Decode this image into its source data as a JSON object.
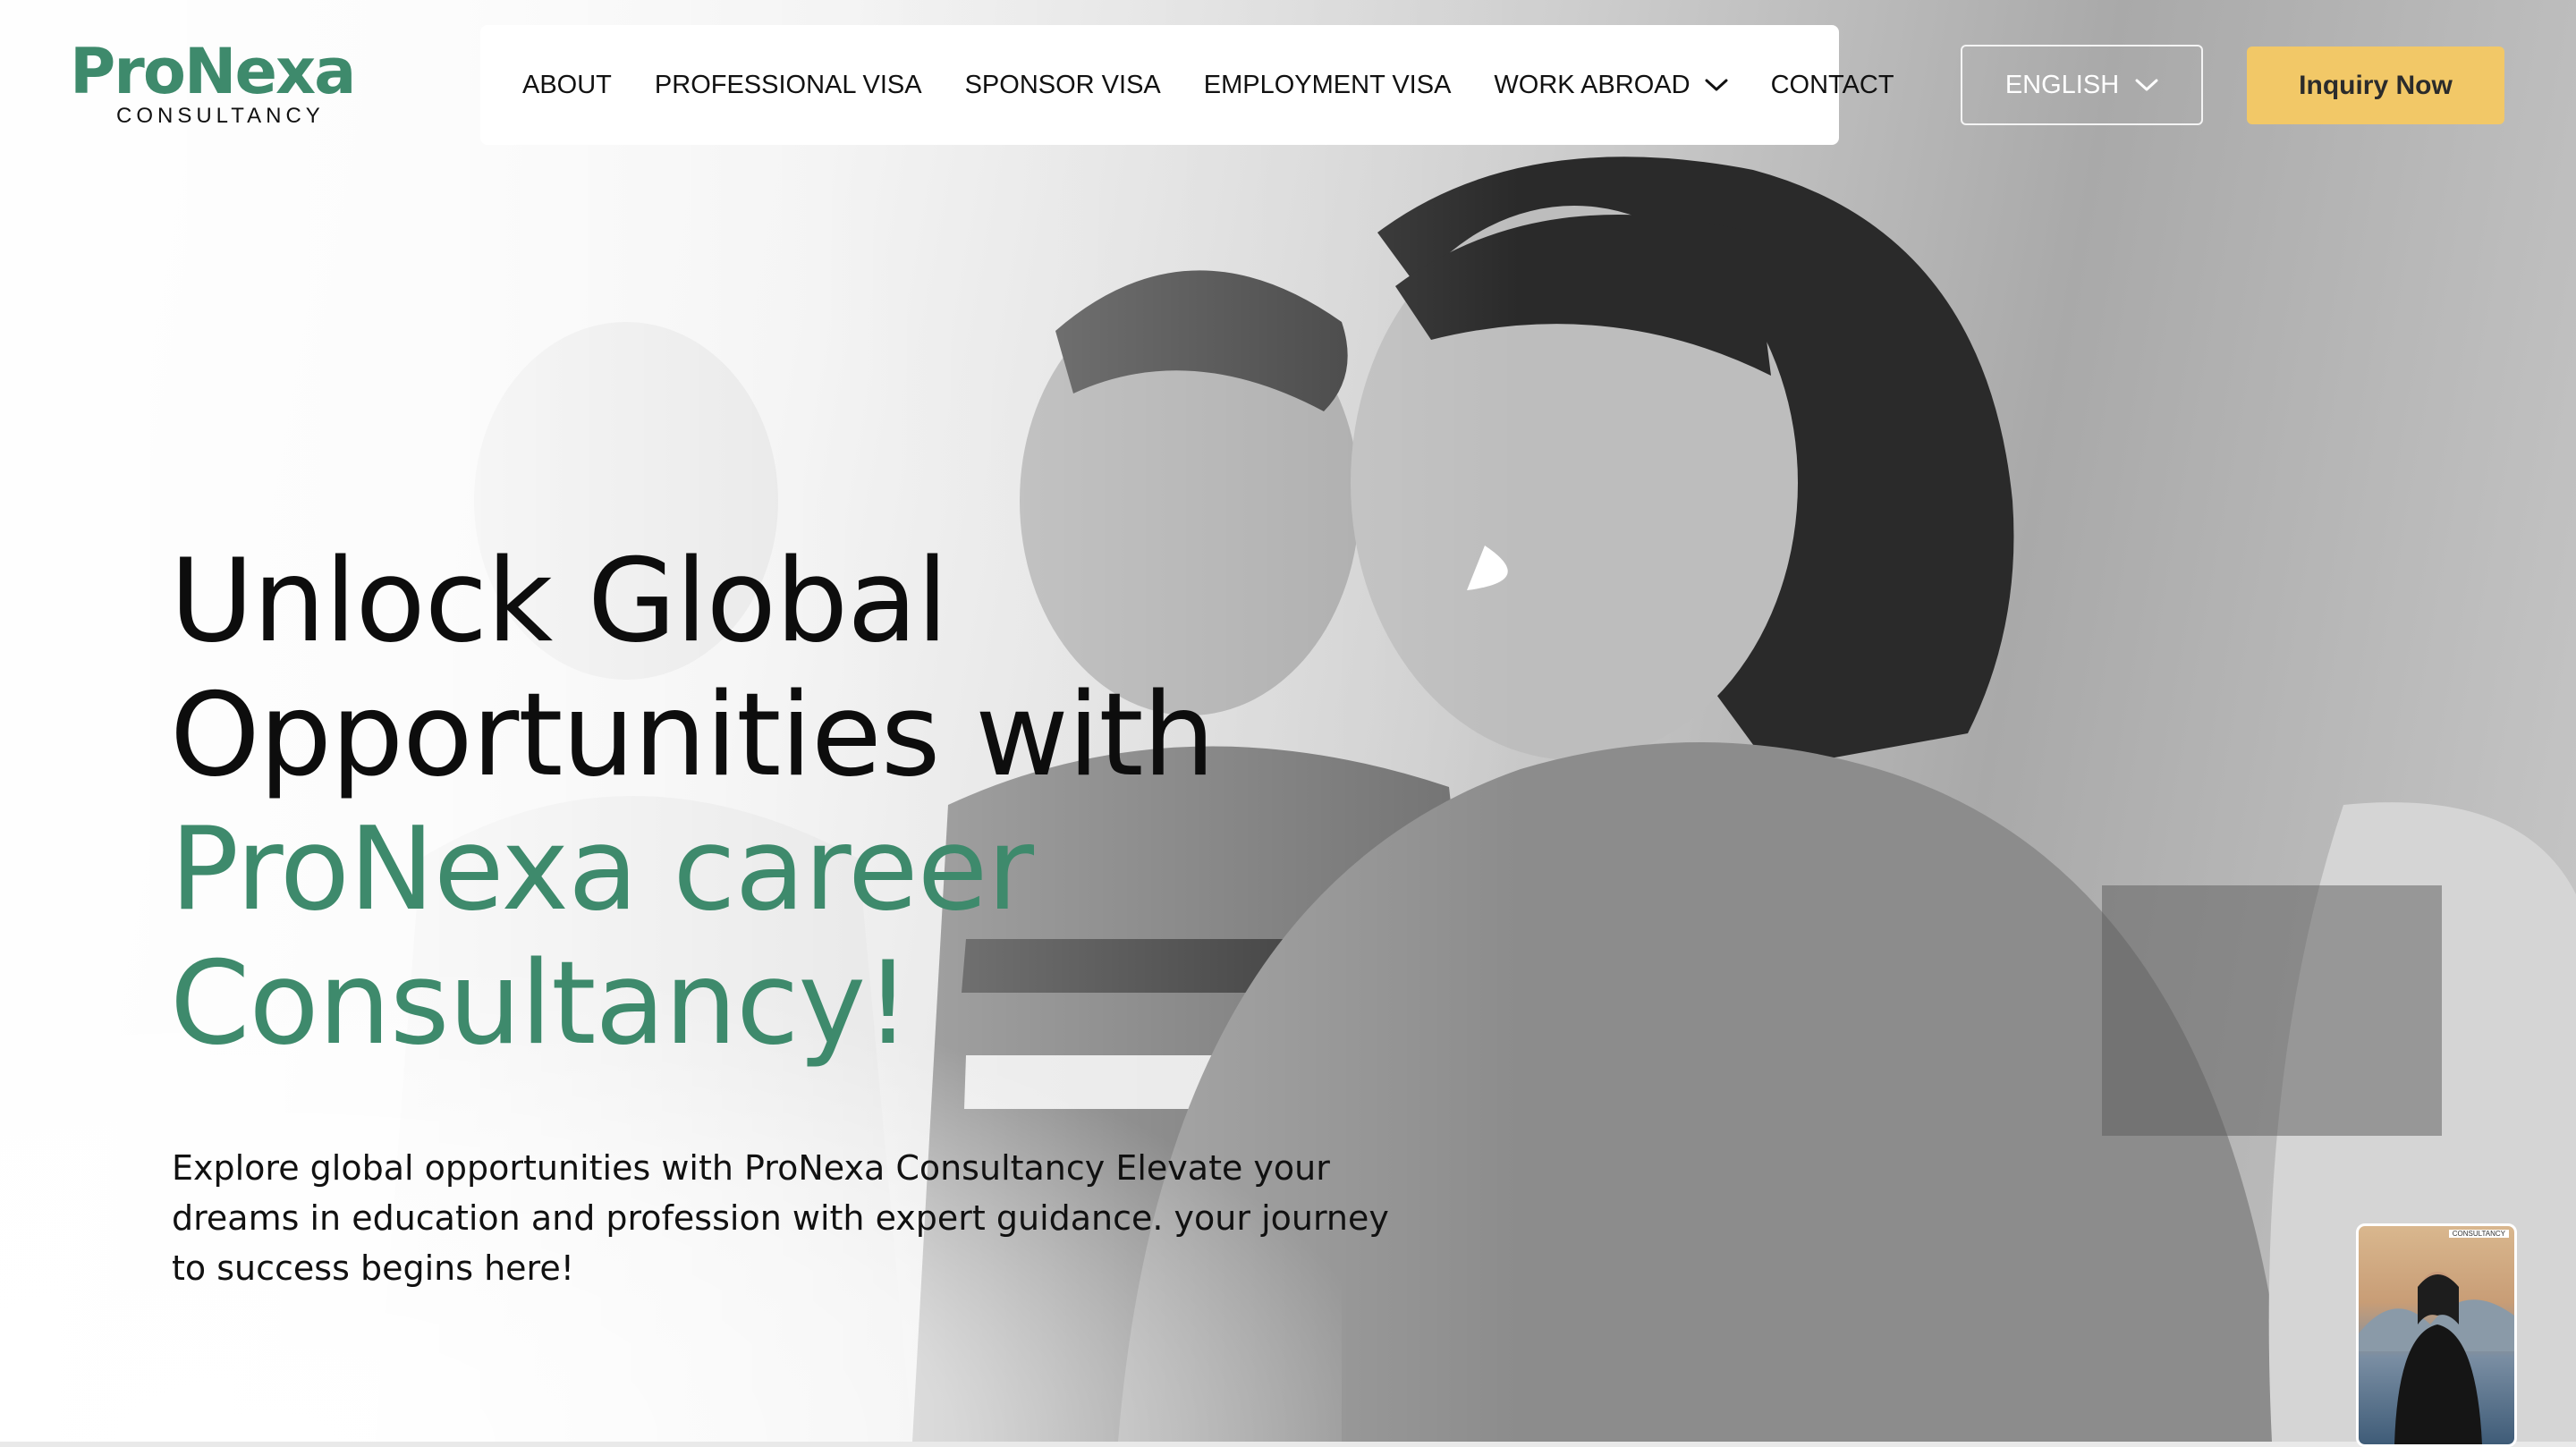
{
  "brand": {
    "name": "ProNexa",
    "tagline": "CONSULTANCY",
    "accent_color": "#3e8a6c",
    "cta_color": "#f2c867"
  },
  "nav": {
    "items": [
      {
        "label": "ABOUT"
      },
      {
        "label": "PROFESSIONAL VISA"
      },
      {
        "label": "SPONSOR VISA"
      },
      {
        "label": "EMPLOYMENT VISA"
      },
      {
        "label": "WORK ABROAD",
        "icon": "chevron-down-icon"
      },
      {
        "label": "CONTACT"
      }
    ]
  },
  "header": {
    "language": "ENGLISH",
    "language_icon": "chevron-down-icon",
    "cta_label": "Inquiry Now"
  },
  "hero": {
    "headline_line1": "Unlock Global",
    "headline_line2": "Opportunities with",
    "headline_accent1": "ProNexa career",
    "headline_accent2": "Consultancy!",
    "description": "Explore global opportunities with ProNexa Consultancy Elevate your dreams in education and profession with expert guidance. your journey to success begins here!"
  },
  "video_widget": {
    "label": "CONSULTANCY"
  }
}
